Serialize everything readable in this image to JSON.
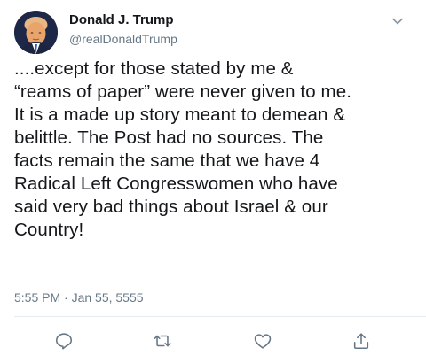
{
  "author": {
    "display_name": "Donald J. Trump",
    "handle": "@realDonaldTrump",
    "avatar": "profile-photo"
  },
  "tweet": {
    "text": "....except for those stated by me &\n“reams of paper” were never given to me.\nIt is a made up story meant to demean &\nbelittle. The Post had no sources. The\nfacts remain the same that we have 4\nRadical Left Congresswomen who have\nsaid very bad things about Israel & our\nCountry!",
    "timestamp": "5:55 PM · Jan 55, 5555"
  },
  "icons": {
    "menu": "chevron-down-icon",
    "reply": "reply-icon",
    "retweet": "retweet-icon",
    "like": "heart-icon",
    "share": "share-icon"
  },
  "colors": {
    "text": "#14171a",
    "secondary": "#657786",
    "icon": "#657786",
    "divider": "#e6ecf0"
  }
}
